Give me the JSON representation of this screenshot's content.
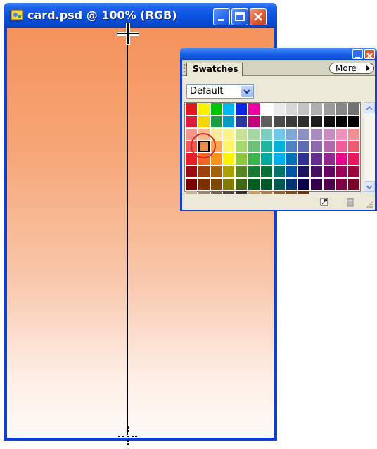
{
  "document_window": {
    "title": "card.psd @ 100% (RGB)",
    "icon": "photoshop-document-icon",
    "buttons": [
      "minimize-icon",
      "maximize-icon",
      "close-icon"
    ],
    "canvas_gradient": {
      "top": "#f4935c",
      "bottom": "#fffbf8"
    },
    "guide_color": "#000000"
  },
  "swatches_panel": {
    "tab_label": "Swatches",
    "more_label": "More",
    "library": "Default",
    "selected_swatch_color": "#e68d4f",
    "selection_ring_color": "#d8262b",
    "swatch_rows": [
      [
        "#e1191e",
        "#fff200",
        "#00c400",
        "#00b8ef",
        "#0a28e6",
        "#ec00a8",
        "#ffffff",
        "#ebebeb",
        "#d7d7d7",
        "#c3c3c3",
        "#afafaf",
        "#9b9b9b",
        "#878787",
        "#737373"
      ],
      [
        "#de1b3f",
        "#f7d600",
        "#1d9b42",
        "#009bc2",
        "#2b3a9b",
        "#c4007c",
        "#5f5f5f",
        "#4b4b4b",
        "#3b3b3b",
        "#2d2d2d",
        "#1e1e1e",
        "#101010",
        "#050505",
        "#000000"
      ],
      [
        "#f7968a",
        "#f9b78c",
        "#fde9a0",
        "#f9f28f",
        "#c7e09a",
        "#a7d8a2",
        "#7ccdc2",
        "#72c8ea",
        "#81a7d8",
        "#8b91c5",
        "#a88bc1",
        "#c88cbf",
        "#f18ebc",
        "#f38f94"
      ],
      [
        "#ef5b52",
        "#e68d4f",
        "#f6a84e",
        "#fff36b",
        "#a6d66f",
        "#6cc177",
        "#22b3a0",
        "#00b2d9",
        "#4f82c3",
        "#5d6bb3",
        "#8e69ae",
        "#b068ae",
        "#ee5e96",
        "#ee5a6f"
      ],
      [
        "#eb1c24",
        "#f26522",
        "#f7941d",
        "#fff200",
        "#8dc63f",
        "#39b54a",
        "#00a99d",
        "#00aeef",
        "#0072bc",
        "#2e3192",
        "#662d91",
        "#92278f",
        "#ec008c",
        "#ed145b"
      ],
      [
        "#9e0b0f",
        "#a0410d",
        "#a36209",
        "#aba000",
        "#598527",
        "#197b30",
        "#007236",
        "#00746b",
        "#0054a6",
        "#1b1464",
        "#440e62",
        "#630460",
        "#9e005d",
        "#9e0039"
      ],
      [
        "#790000",
        "#7b2e00",
        "#7d4900",
        "#827b00",
        "#406618",
        "#005e20",
        "#005826",
        "#005952",
        "#003471",
        "#0d004c",
        "#32004b",
        "#4b0049",
        "#7b0046",
        "#7a0026"
      ],
      [
        "#c7b299",
        "#998675",
        "#736357",
        "#534741",
        "#37302a",
        "#c69c6d",
        "#a67c52",
        "#8c6239",
        "#754c24",
        "#603913"
      ]
    ],
    "footer_icons": [
      "new-swatch-icon",
      "trash-icon"
    ]
  }
}
